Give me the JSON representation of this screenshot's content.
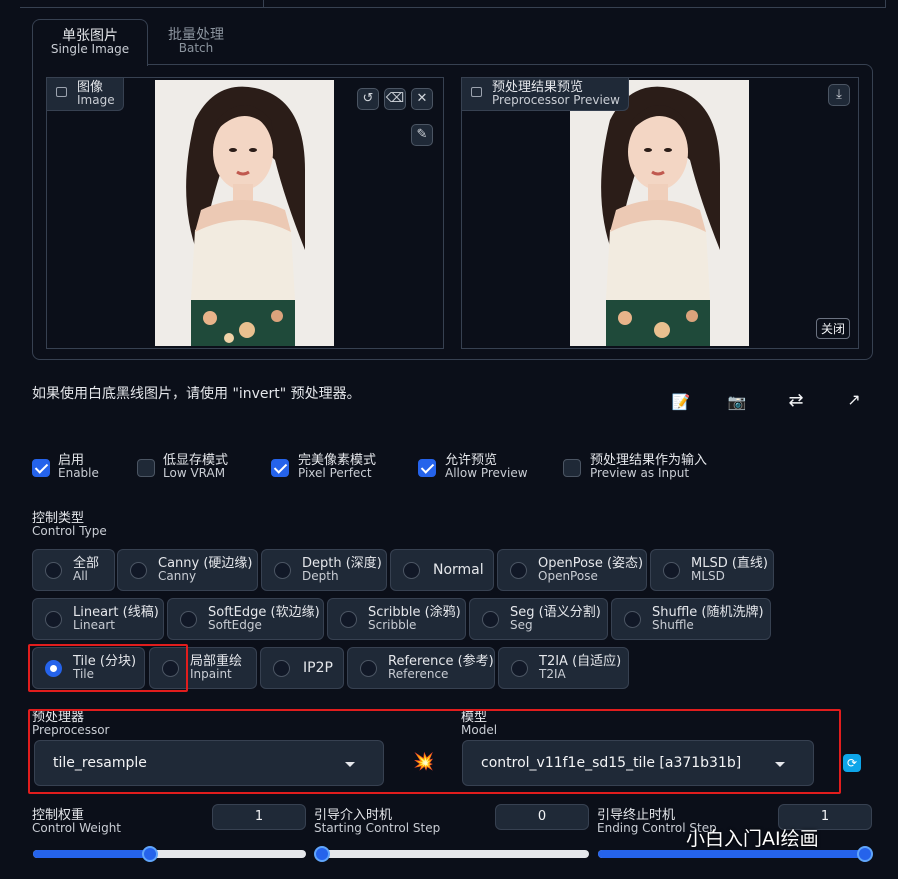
{
  "tabs": [
    {
      "zh": "单张图片",
      "en": "Single Image",
      "active": true
    },
    {
      "zh": "批量处理",
      "en": "Batch",
      "active": false
    }
  ],
  "image_input": {
    "zh": "图像",
    "en": "Image",
    "icon": "image-icon"
  },
  "preview": {
    "zh": "预处理结果预览",
    "en": "Preprocessor Preview",
    "close_label": "关闭"
  },
  "hint": "如果使用白底黑线图片，请使用 \"invert\" 预处理器。",
  "checkboxes": [
    {
      "zh": "启用",
      "en": "Enable",
      "checked": true
    },
    {
      "zh": "低显存模式",
      "en": "Low VRAM",
      "checked": false
    },
    {
      "zh": "完美像素模式",
      "en": "Pixel Perfect",
      "checked": true
    },
    {
      "zh": "允许预览",
      "en": "Allow Preview",
      "checked": true
    },
    {
      "zh": "预处理结果作为输入",
      "en": "Preview as Input",
      "checked": false
    }
  ],
  "control_type": {
    "zh": "控制类型",
    "en": "Control Type",
    "options": [
      {
        "zh": "全部",
        "en": "All"
      },
      {
        "zh": "Canny (硬边缘)",
        "en": "Canny"
      },
      {
        "zh": "Depth (深度)",
        "en": "Depth"
      },
      {
        "zh": "Normal",
        "en": ""
      },
      {
        "zh": "OpenPose (姿态)",
        "en": "OpenPose"
      },
      {
        "zh": "MLSD (直线)",
        "en": "MLSD"
      },
      {
        "zh": "Lineart (线稿)",
        "en": "Lineart"
      },
      {
        "zh": "SoftEdge (软边缘)",
        "en": "SoftEdge"
      },
      {
        "zh": "Scribble (涂鸦)",
        "en": "Scribble"
      },
      {
        "zh": "Seg (语义分割)",
        "en": "Seg"
      },
      {
        "zh": "Shuffle (随机洗牌)",
        "en": "Shuffle"
      },
      {
        "zh": "Tile (分块)",
        "en": "Tile"
      },
      {
        "zh": "局部重绘",
        "en": "Inpaint"
      },
      {
        "zh": "IP2P",
        "en": ""
      },
      {
        "zh": "Reference (参考)",
        "en": "Reference"
      },
      {
        "zh": "T2IA (自适应)",
        "en": "T2IA"
      }
    ],
    "selected": "Tile (分块)"
  },
  "preprocessor": {
    "zh": "预处理器",
    "en": "Preprocessor",
    "value": "tile_resample"
  },
  "model": {
    "zh": "模型",
    "en": "Model",
    "value": "control_v11f1e_sd15_tile [a371b31b]"
  },
  "sliders": [
    {
      "zh": "控制权重",
      "en": "Control Weight",
      "value": "1",
      "fraction": 0.43
    },
    {
      "zh": "引导介入时机",
      "en": "Starting Control Step",
      "value": "0",
      "fraction": 0.0
    },
    {
      "zh": "引导终止时机",
      "en": "Ending Control Step",
      "value": "1",
      "fraction": 1.0
    }
  ],
  "watermark": "小白入门AI绘画",
  "colors": {
    "accent": "#2563eb",
    "highlight": "#e11d1d",
    "background": "#0b0f19"
  }
}
